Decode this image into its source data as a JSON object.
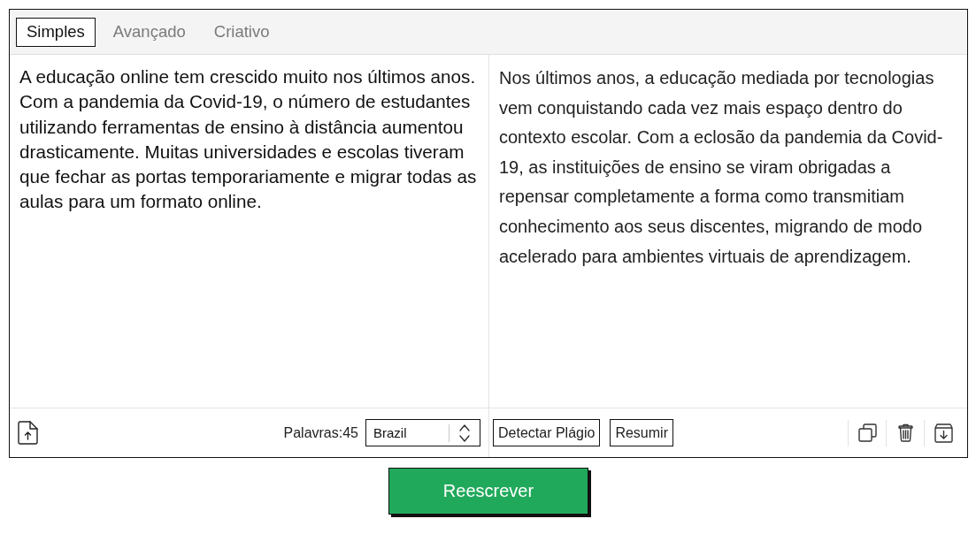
{
  "tabs": [
    {
      "label": "Simples",
      "selected": true
    },
    {
      "label": "Avançado",
      "selected": false
    },
    {
      "label": "Criativo",
      "selected": false
    }
  ],
  "input_panel": {
    "text": "A educação online tem crescido muito nos últimos anos. Com a pandemia da Covid-19, o número de estudantes utilizando ferramentas de ensino à distância aumentou drasticamente. Muitas universidades e escolas tiveram que fechar as portas temporariamente e migrar todas as aulas para um formato online.",
    "word_count": "Palavras:45",
    "language_select": {
      "value": "Brazil"
    }
  },
  "output_panel": {
    "text": "Nos últimos anos, a educação mediada por tecnologias vem conquistando cada vez mais espaço dentro do contexto escolar. Com a eclosão da pandemia da Covid-19, as instituições de ensino se viram obrigadas a repensar completamente a forma como transmitiam conhecimento aos seus discentes, migrando de modo acelerado para ambientes virtuais de aprendizagem.",
    "actions": [
      "Detectar Plágio",
      "Resumir"
    ]
  },
  "primary_button": "Reescrever"
}
